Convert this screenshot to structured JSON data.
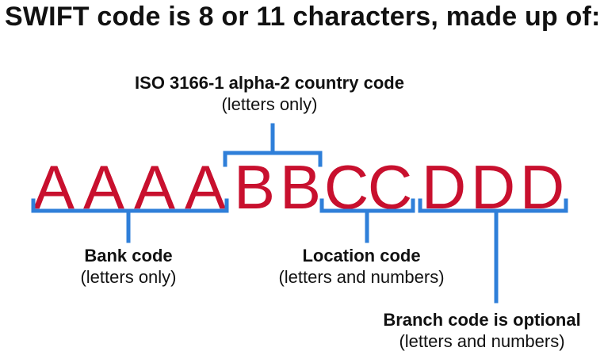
{
  "title": "SWIFT code is 8 or 11 characters, made up of:",
  "code_letters": [
    "A",
    "A",
    "A",
    "A",
    "B",
    "B",
    "C",
    "C",
    "D",
    "D",
    "D"
  ],
  "segments": {
    "country": {
      "label": "ISO 3166-1 alpha-2 country code",
      "sublabel": "(letters only)"
    },
    "bank": {
      "label": "Bank code",
      "sublabel": "(letters only)"
    },
    "location": {
      "label": "Location code",
      "sublabel": "(letters and numbers)"
    },
    "branch": {
      "label": "Branch code is optional",
      "sublabel": "(letters and numbers)"
    }
  },
  "colors": {
    "letters": "#c8102e",
    "brackets": "#2f7fd9",
    "text": "#111111"
  }
}
